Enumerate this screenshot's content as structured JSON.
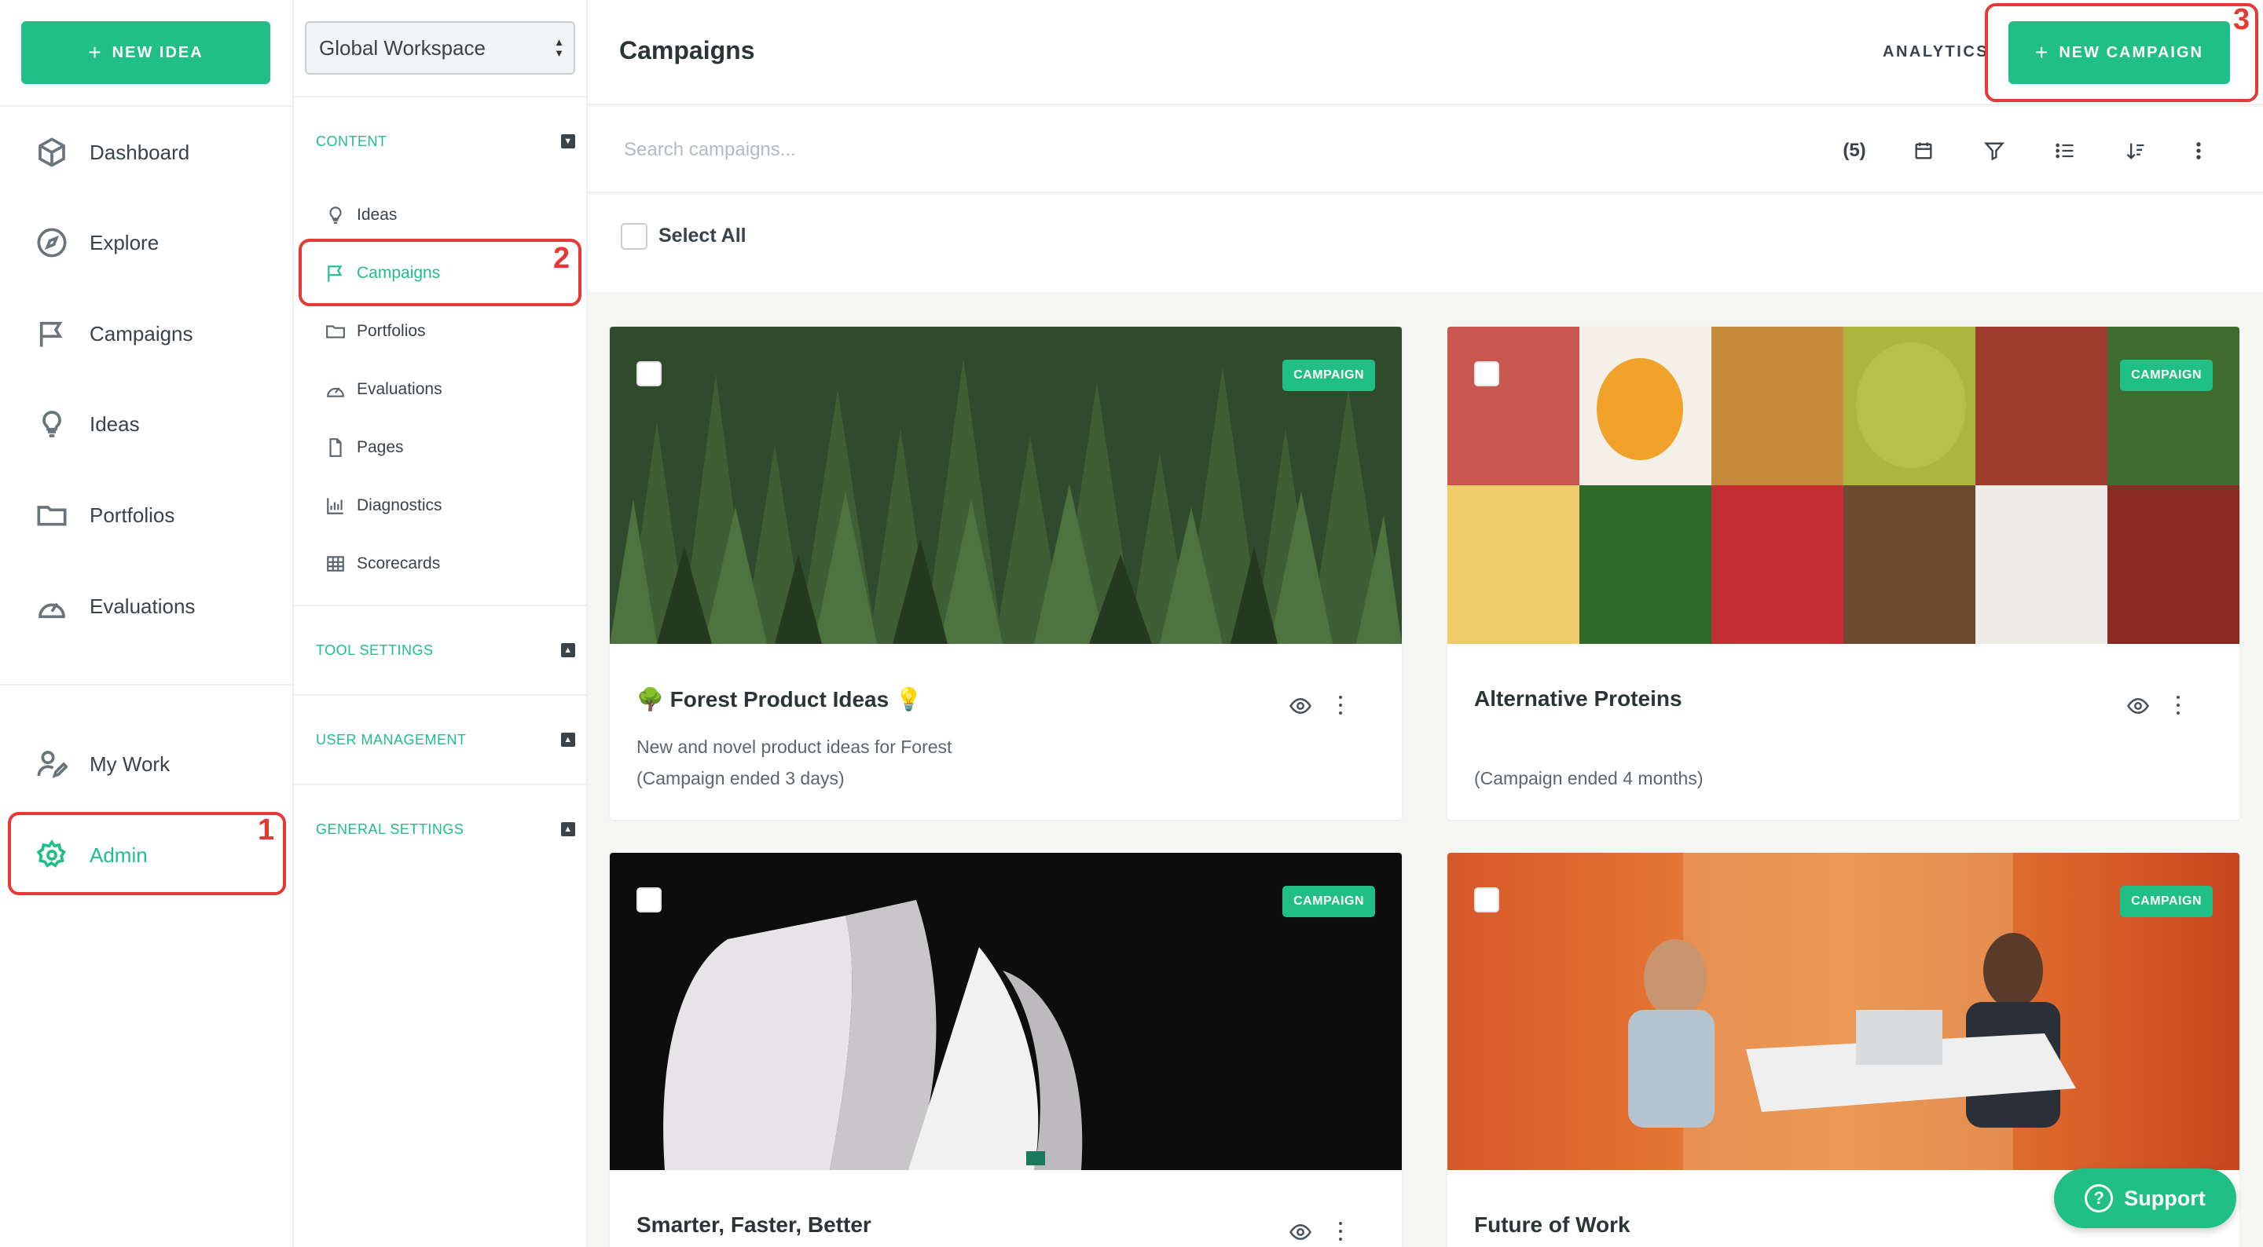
{
  "leftnav": {
    "new_idea_label": "NEW IDEA",
    "items": [
      {
        "label": "Dashboard"
      },
      {
        "label": "Explore"
      },
      {
        "label": "Campaigns"
      },
      {
        "label": "Ideas"
      },
      {
        "label": "Portfolios"
      },
      {
        "label": "Evaluations"
      },
      {
        "label": "My Work"
      },
      {
        "label": "Admin"
      }
    ]
  },
  "subnav": {
    "workspace": "Global Workspace",
    "sections": [
      {
        "label": "CONTENT"
      },
      {
        "label": "TOOL SETTINGS"
      },
      {
        "label": "USER MANAGEMENT"
      },
      {
        "label": "GENERAL SETTINGS"
      }
    ],
    "content_items": [
      {
        "label": "Ideas"
      },
      {
        "label": "Campaigns"
      },
      {
        "label": "Portfolios"
      },
      {
        "label": "Evaluations"
      },
      {
        "label": "Pages"
      },
      {
        "label": "Diagnostics"
      },
      {
        "label": "Scorecards"
      }
    ]
  },
  "header": {
    "title": "Campaigns",
    "analytics_label": "ANALYTICS",
    "new_campaign_label": "NEW CAMPAIGN"
  },
  "toolbar": {
    "search_placeholder": "Search campaigns...",
    "count": "(5)"
  },
  "select_all_label": "Select All",
  "cards": [
    {
      "badge": "CAMPAIGN",
      "title": "Forest Product Ideas",
      "description": "New and novel product ideas for Forest",
      "ended": "(Campaign ended 3 days)"
    },
    {
      "badge": "CAMPAIGN",
      "title": "Alternative Proteins",
      "description": "",
      "ended": "(Campaign ended 4 months)"
    },
    {
      "badge": "CAMPAIGN",
      "title": "Smarter, Faster, Better",
      "description": "",
      "ended": ""
    },
    {
      "badge": "CAMPAIGN",
      "title": "Future of Work",
      "description": "",
      "ended": ""
    }
  ],
  "annotations": [
    "1",
    "2",
    "3"
  ],
  "support_label": "Support",
  "colors": {
    "accent": "#1fbf85",
    "annotation": "#e53935"
  }
}
